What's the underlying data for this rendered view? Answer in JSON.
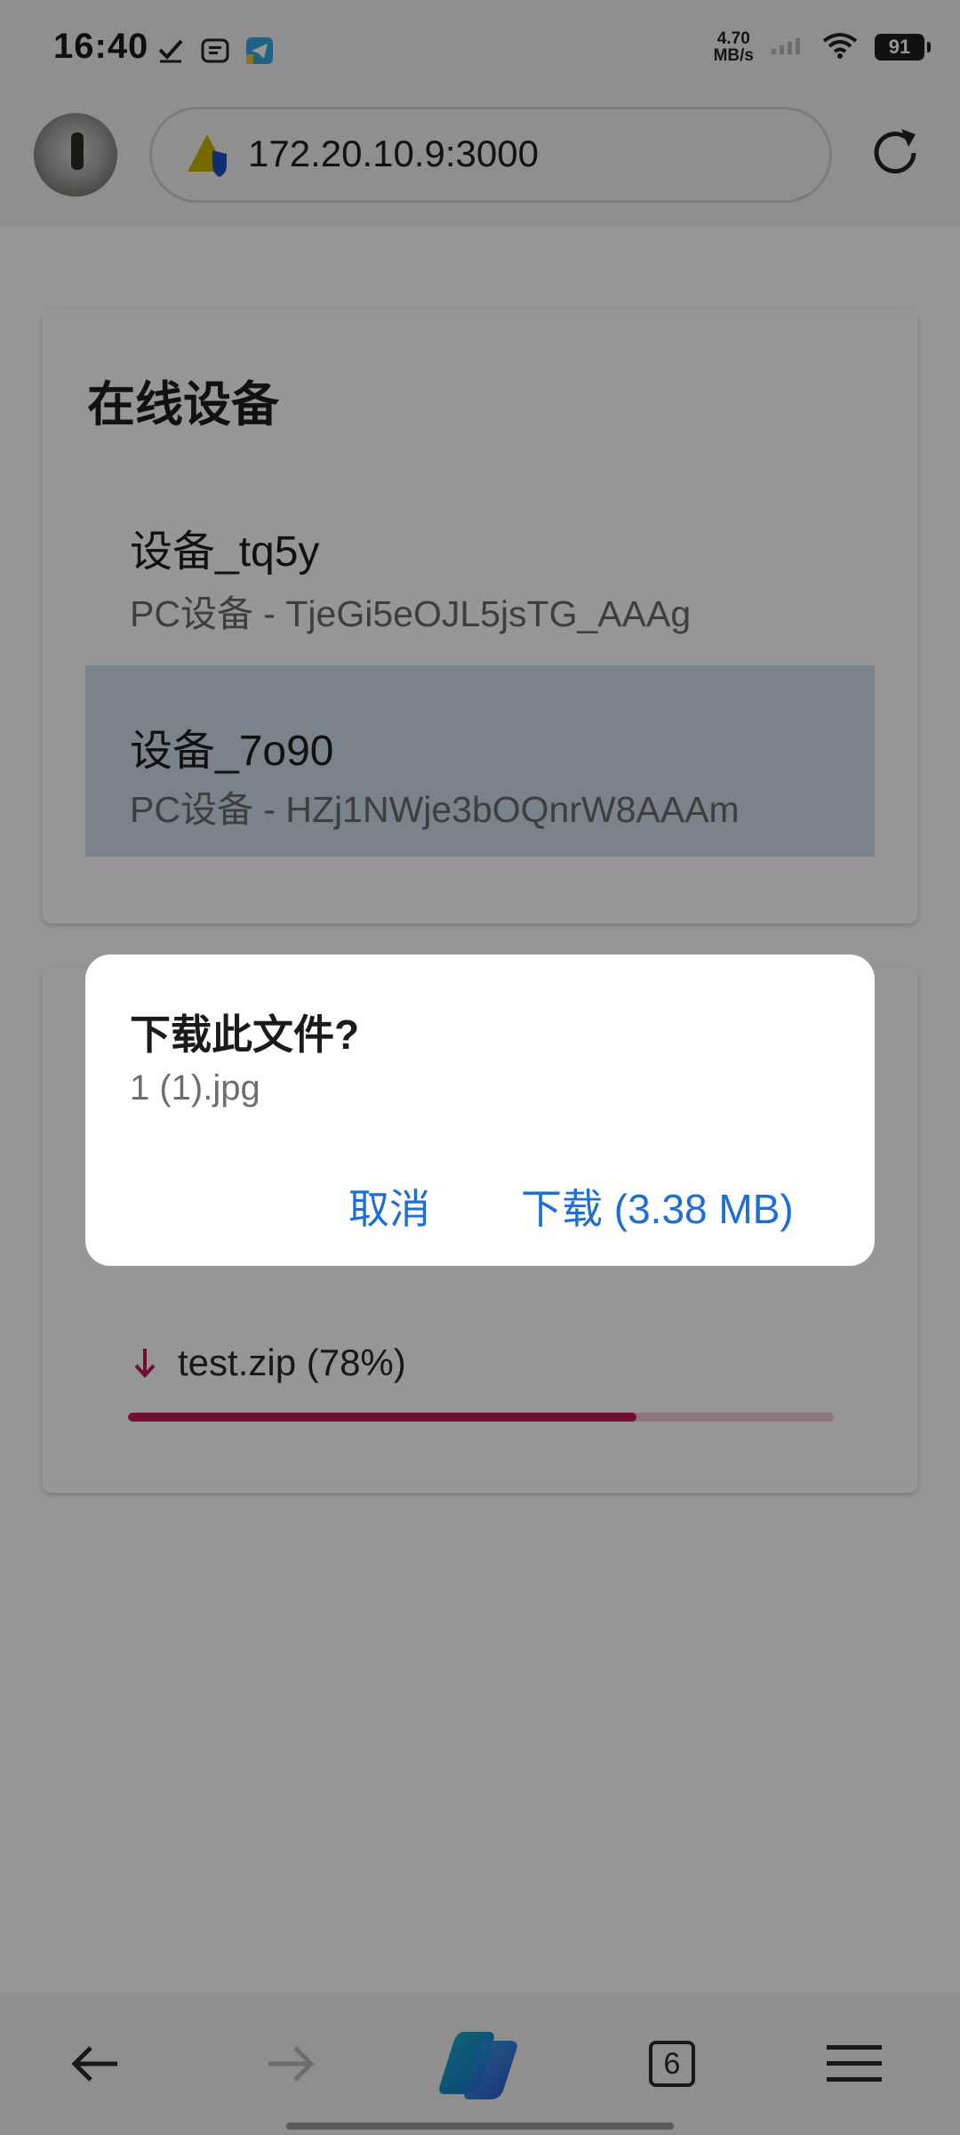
{
  "status_bar": {
    "time": "16:40",
    "net_speed_value": "4.70",
    "net_speed_unit": "MB/s",
    "battery": "91"
  },
  "browser": {
    "url": "172.20.10.9:3000"
  },
  "devices_card": {
    "title": "在线设备",
    "items": [
      {
        "name": "设备_tq5y",
        "desc": "PC设备 - TjeGi5eOJL5jsTG_AAAg",
        "selected": false
      },
      {
        "name": "设备_7o90",
        "desc": "PC设备 - HZj1NWje3bOQnrW8AAAm",
        "selected": true
      }
    ]
  },
  "transfer": {
    "label": "test.zip (78%)",
    "progress_percent": 72,
    "bar_color": "#c2185b",
    "track_color": "#f2c9d7"
  },
  "dialog": {
    "title": "下载此文件?",
    "filename": "1 (1).jpg",
    "cancel_label": "取消",
    "download_label": "下载 (3.38 MB)",
    "button_color": "#1f6fd1"
  },
  "bottom_nav": {
    "tab_count": "6"
  }
}
